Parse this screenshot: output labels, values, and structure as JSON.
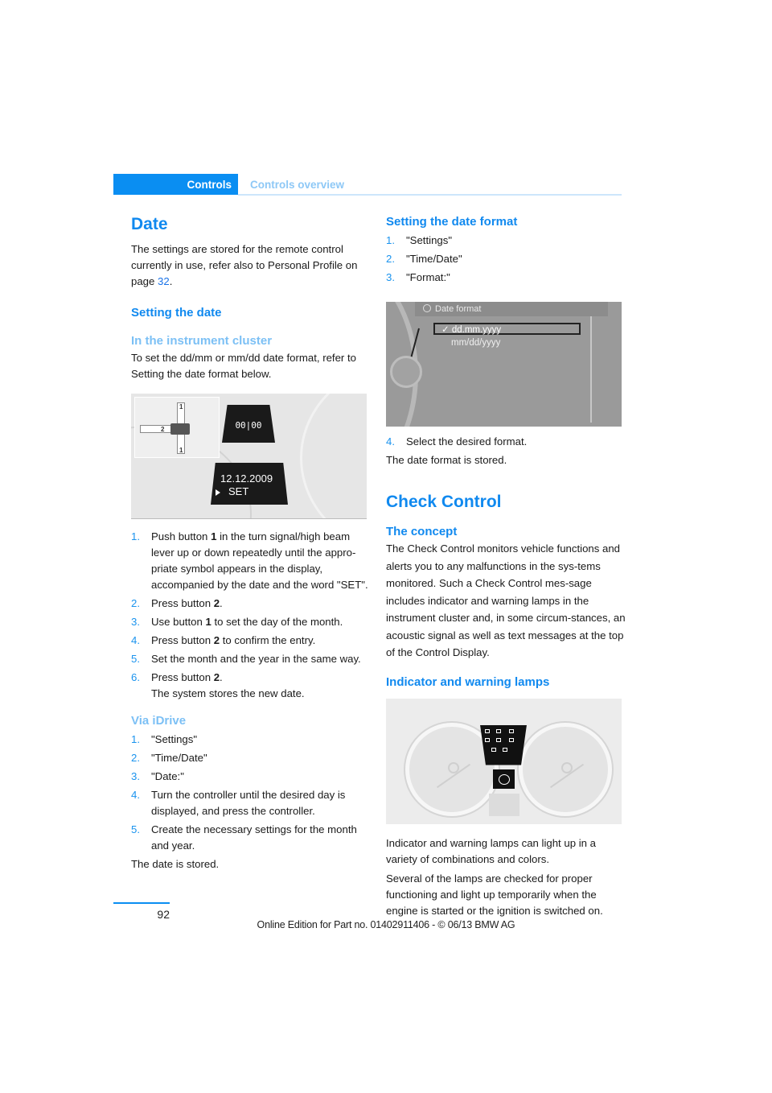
{
  "header": {
    "section_tab": "Controls",
    "subsection": "Controls overview"
  },
  "left": {
    "date_heading": "Date",
    "date_intro_prefix": "The settings are stored for the remote control currently in use, refer also to Personal Profile on page ",
    "date_intro_link": "32",
    "date_intro_suffix": ".",
    "setting_date_heading": "Setting the date",
    "cluster_heading": "In the instrument cluster",
    "cluster_intro": "To set the dd/mm or mm/dd date format, refer to Setting the date format below.",
    "figure1": {
      "display_symbol": "00|00",
      "display_date": "12.12.2009",
      "display_word": "SET",
      "lever_label_1": "1",
      "lever_label_2": "2"
    },
    "cluster_steps": [
      {
        "num": "1.",
        "pre": "Push button ",
        "bold": "1",
        "post": " in the turn signal/high beam lever up or down repeatedly until the appro-priate symbol appears in the display, accompanied by the date and the word \"SET\"."
      },
      {
        "num": "2.",
        "pre": "Press button ",
        "bold": "2",
        "post": "."
      },
      {
        "num": "3.",
        "pre": "Use button ",
        "bold": "1",
        "post": " to set the day of the month."
      },
      {
        "num": "4.",
        "pre": "Press button ",
        "bold": "2",
        "post": " to confirm the entry."
      },
      {
        "num": "5.",
        "pre": "Set the month and the year in the same way.",
        "bold": "",
        "post": ""
      },
      {
        "num": "6.",
        "pre": "Press button ",
        "bold": "2",
        "post": ".",
        "extra": "The system stores the new date."
      }
    ],
    "idrive_heading": "Via iDrive",
    "idrive_steps": [
      {
        "num": "1.",
        "text": "\"Settings\""
      },
      {
        "num": "2.",
        "text": "\"Time/Date\""
      },
      {
        "num": "3.",
        "text": "\"Date:\""
      },
      {
        "num": "4.",
        "text": "Turn the controller until the desired day is displayed, and press the controller."
      },
      {
        "num": "5.",
        "text": "Create the necessary settings for the month and year."
      }
    ],
    "idrive_result": "The date is stored."
  },
  "right": {
    "format_heading": "Setting the date format",
    "format_steps": [
      {
        "num": "1.",
        "text": "\"Settings\""
      },
      {
        "num": "2.",
        "text": "\"Time/Date\""
      },
      {
        "num": "3.",
        "text": "\"Format:\""
      }
    ],
    "figure2": {
      "title": "Date format",
      "options": [
        {
          "label": "dd.mm.yyyy",
          "selected": true,
          "check": "✓"
        },
        {
          "label": "mm/dd/yyyy",
          "selected": false
        }
      ]
    },
    "format_step4": {
      "num": "4.",
      "text": "Select the desired format."
    },
    "format_result": "The date format is stored.",
    "check_heading": "Check Control",
    "concept_heading": "The concept",
    "concept_text": "The Check Control monitors vehicle functions and alerts you to any malfunctions in the sys-tems monitored. Such a Check Control mes-sage includes indicator and warning lamps in the instrument cluster and, in some circum-stances, an acoustic signal as well as text messages at the top of the Control Display.",
    "lamps_heading": "Indicator and warning lamps",
    "lamps_text1": "Indicator and warning lamps can light up in a variety of combinations and colors.",
    "lamps_text2": "Several of the lamps are checked for proper functioning and light up temporarily when the engine is started or the ignition is switched on."
  },
  "footer": {
    "page_number": "92",
    "edition": "Online Edition for Part no. 01402911406 - © 06/13 BMW AG"
  },
  "colors": {
    "accent": "#0a8ef2",
    "heading": "#1089ef",
    "subheading_light": "#7cc0f5",
    "header_sub": "#8ec8f6"
  }
}
